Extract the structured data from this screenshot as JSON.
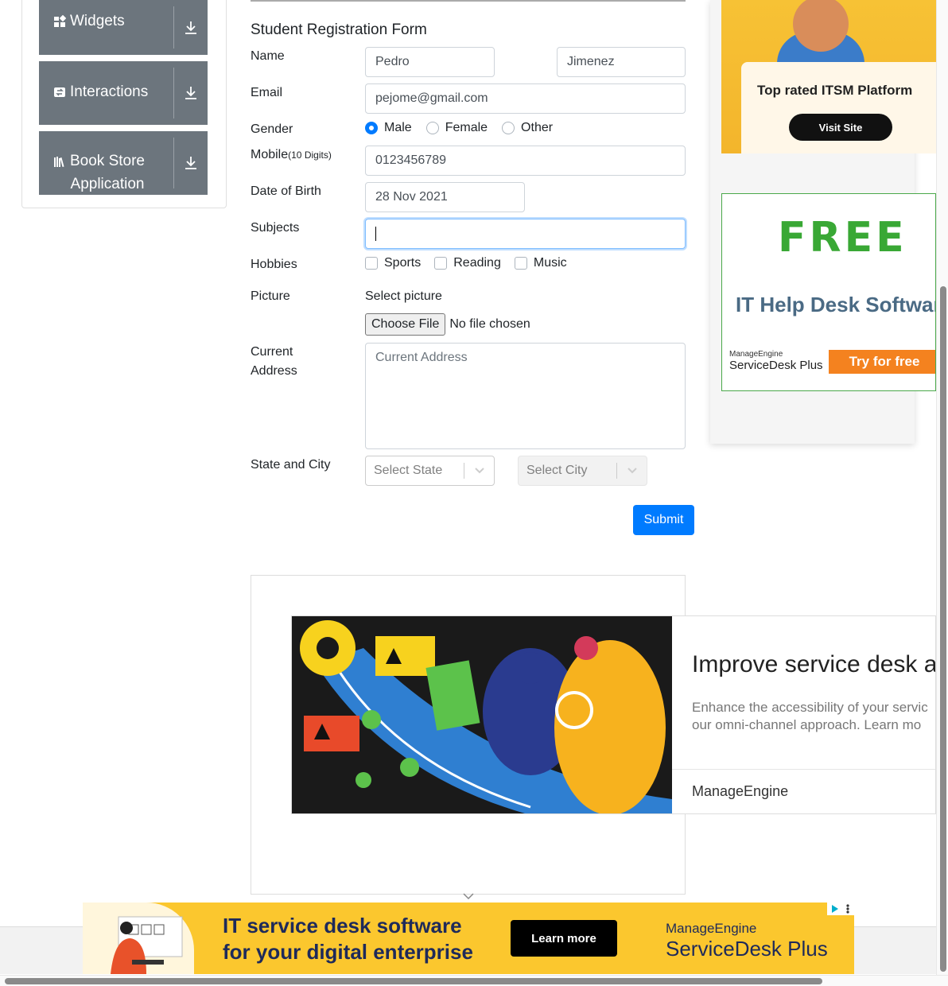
{
  "sidebar": {
    "groups": [
      {
        "label": "Widgets",
        "icon": "widgets-icon"
      },
      {
        "label": "Interactions",
        "icon": "interactions-icon"
      },
      {
        "label": "Book Store Application",
        "label_line1": "Book Store",
        "label_line2": "Application",
        "icon": "books-icon"
      }
    ]
  },
  "form": {
    "title": "Student Registration Form",
    "labels": {
      "name": "Name",
      "email": "Email",
      "gender": "Gender",
      "mobile": "Mobile",
      "mobile_hint": "(10 Digits)",
      "dob": "Date of Birth",
      "subjects": "Subjects",
      "hobbies": "Hobbies",
      "picture": "Picture",
      "address_line1": "Current",
      "address_line2": "Address",
      "state_city": "State and City"
    },
    "first_name": "Pedro",
    "last_name": "Jimenez",
    "email": "pejome@gmail.com",
    "gender_options": [
      "Male",
      "Female",
      "Other"
    ],
    "gender_selected": "Male",
    "mobile": "0123456789",
    "dob": "28 Nov 2021",
    "subjects": "",
    "hobbies": [
      "Sports",
      "Reading",
      "Music"
    ],
    "hobbies_checked": [],
    "picture_label": "Select picture",
    "file_button": "Choose File",
    "file_status": "No file chosen",
    "address_placeholder": "Current Address",
    "state_placeholder": "Select State",
    "city_placeholder": "Select City",
    "submit": "Submit"
  },
  "ads": {
    "itsm": {
      "title": "Top rated ITSM Platform",
      "cta": "Visit Site"
    },
    "helpdesk": {
      "free": "FREE",
      "title": "IT Help Desk Softwar",
      "brand_small": "ManageEngine",
      "brand": "ServiceDesk Plus",
      "cta": "Try for free"
    },
    "service_desk": {
      "headline": "Improve service desk a",
      "body_line1": "Enhance the accessibility of your servic",
      "body_line2": "our omni-channel approach. Learn mo",
      "brand": "ManageEngine"
    },
    "banner": {
      "line1": "IT service desk software",
      "line2": "for your digital enterprise",
      "cta": "Learn more",
      "brand_small": "ManageEngine",
      "brand": "ServiceDesk Plus"
    }
  },
  "colors": {
    "primary": "#007bff",
    "sidebar": "#6c757d",
    "banner": "#fbc72e"
  }
}
